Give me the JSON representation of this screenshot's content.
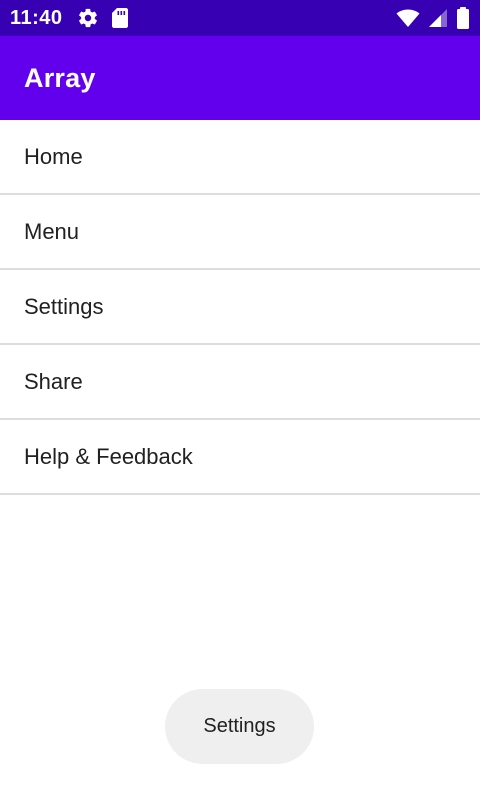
{
  "status_bar": {
    "time": "11:40",
    "icons": [
      "gear-icon",
      "sd-card-icon",
      "wifi-icon",
      "cell-signal-icon",
      "battery-icon"
    ],
    "background": "#3700b3"
  },
  "app_bar": {
    "title": "Array",
    "background": "#6200ee"
  },
  "list": {
    "items": [
      {
        "label": "Home"
      },
      {
        "label": "Menu"
      },
      {
        "label": "Settings"
      },
      {
        "label": "Share"
      },
      {
        "label": "Help & Feedback"
      }
    ]
  },
  "toast": {
    "text": "Settings"
  }
}
